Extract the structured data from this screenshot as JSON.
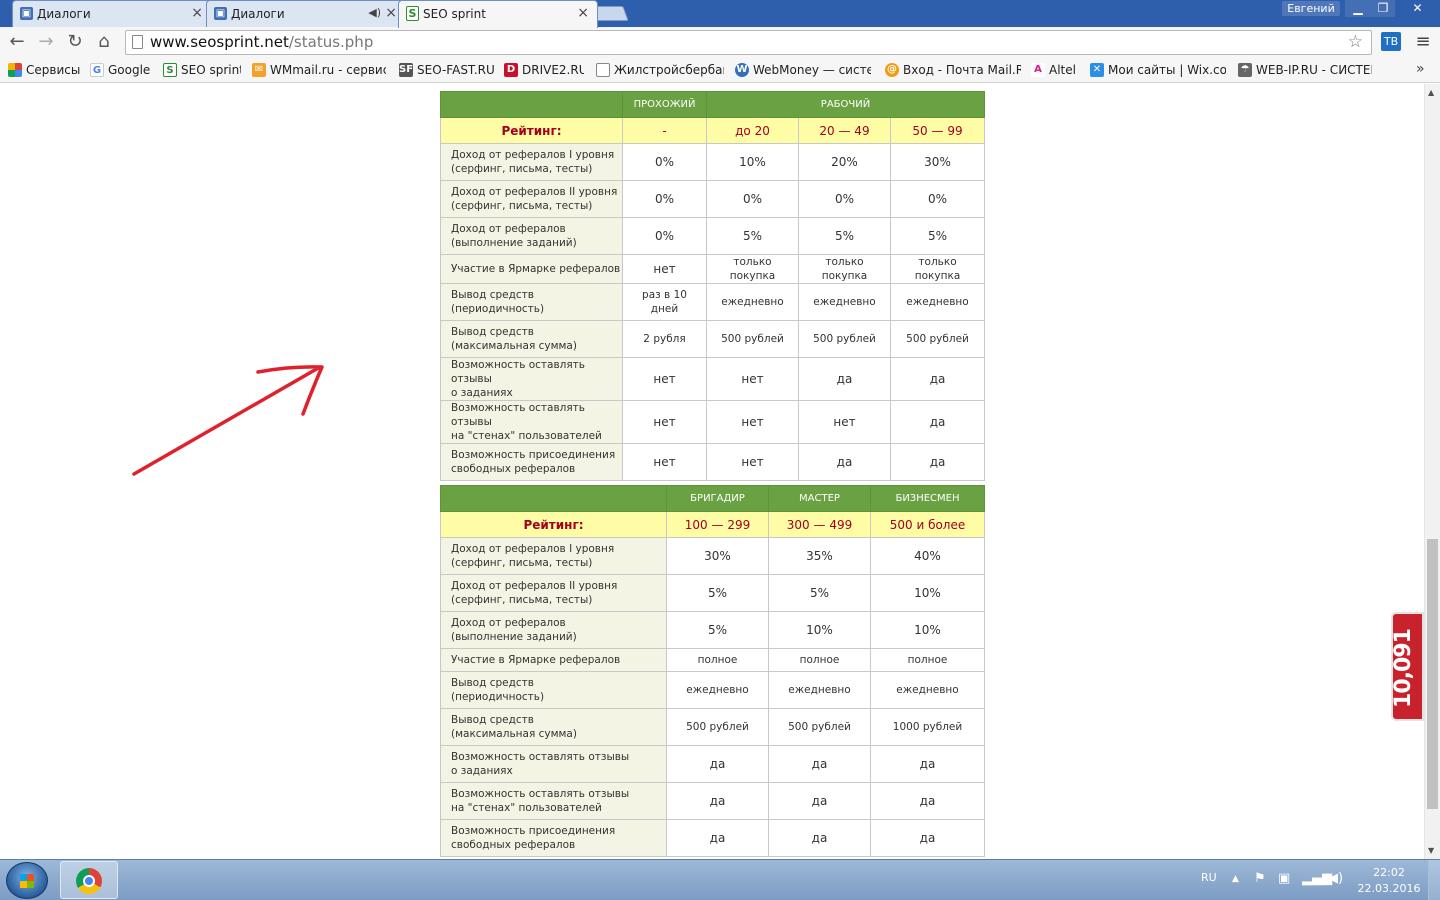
{
  "browser": {
    "tabs": [
      {
        "title": "Диалоги"
      },
      {
        "title": "Диалоги"
      },
      {
        "title": "SEO sprint"
      }
    ],
    "close_glyph": "×",
    "user": "Евгений",
    "url_host": "www.seosprint.net",
    "url_path": "/status.php",
    "bookmarks": [
      {
        "label": "Сервисы",
        "icon": "apps-grid-icon"
      },
      {
        "label": "Google",
        "icon": "google-icon"
      },
      {
        "label": "SEO sprint",
        "icon": "seosprint-icon"
      },
      {
        "label": "WMmail.ru - сервис п",
        "icon": "wmmail-icon"
      },
      {
        "label": "SEO-FAST.RU",
        "icon": "seofast-icon"
      },
      {
        "label": "DRIVE2.RU",
        "icon": "drive2-icon"
      },
      {
        "label": "Жилстройсбербанк",
        "icon": "page-icon"
      },
      {
        "label": "WebMoney — систем",
        "icon": "webmoney-icon"
      },
      {
        "label": "Вход - Почта Mail.Ru",
        "icon": "mailru-icon"
      },
      {
        "label": "Altel",
        "icon": "altel-icon"
      },
      {
        "label": "Мои сайты | Wix.com",
        "icon": "wix-icon"
      },
      {
        "label": "WEB-IP.RU - СИСТЕМ",
        "icon": "webip-icon"
      }
    ],
    "extension_label": "ТВ"
  },
  "table1": {
    "group_headers": [
      "ПРОХОЖИЙ",
      "РАБОЧИЙ"
    ],
    "rating_label": "Рейтинг:",
    "ratings": [
      "-",
      "до 20",
      "20 — 49",
      "50 — 99"
    ],
    "rows": [
      {
        "label": [
          "Доход от рефералов I уровня",
          "(серфинг, письма, тесты)"
        ],
        "values": [
          "0%",
          "10%",
          "20%",
          "30%"
        ]
      },
      {
        "label": [
          "Доход от рефералов II уровня",
          "(серфинг, письма, тесты)"
        ],
        "values": [
          "0%",
          "0%",
          "0%",
          "0%"
        ]
      },
      {
        "label": [
          "Доход от рефералов",
          "(выполнение заданий)"
        ],
        "values": [
          "0%",
          "5%",
          "5%",
          "5%"
        ]
      },
      {
        "label": [
          "Участие в Ярмарке рефералов",
          ""
        ],
        "values": [
          "нет",
          "только покупка",
          "только покупка",
          "только покупка"
        ]
      },
      {
        "label": [
          "Вывод средств",
          "(периодичность)"
        ],
        "values": [
          "раз в 10 дней",
          "ежедневно",
          "ежедневно",
          "ежедневно"
        ]
      },
      {
        "label": [
          "Вывод средств",
          "(максимальная сумма)"
        ],
        "values": [
          "2 рубля",
          "500 рублей",
          "500 рублей",
          "500 рублей"
        ]
      },
      {
        "label": [
          "Возможность оставлять отзывы",
          "о заданиях"
        ],
        "values": [
          "нет",
          "нет",
          "да",
          "да"
        ]
      },
      {
        "label": [
          "Возможность оставлять отзывы",
          "на \"стенах\" пользователей"
        ],
        "values": [
          "нет",
          "нет",
          "нет",
          "да"
        ]
      },
      {
        "label": [
          "Возможность присоединения",
          "свободных рефералов"
        ],
        "values": [
          "нет",
          "нет",
          "да",
          "да"
        ]
      }
    ]
  },
  "table2": {
    "headers": [
      "БРИГАДИР",
      "МАСТЕР",
      "БИЗНЕСМЕН"
    ],
    "rating_label": "Рейтинг:",
    "ratings": [
      "100 — 299",
      "300 — 499",
      "500 и более"
    ],
    "rows": [
      {
        "label": [
          "Доход от рефералов I уровня",
          "(серфинг, письма, тесты)"
        ],
        "values": [
          "30%",
          "35%",
          "40%"
        ]
      },
      {
        "label": [
          "Доход от рефералов II уровня",
          "(серфинг, письма, тесты)"
        ],
        "values": [
          "5%",
          "5%",
          "10%"
        ]
      },
      {
        "label": [
          "Доход от рефералов",
          "(выполнение заданий)"
        ],
        "values": [
          "5%",
          "10%",
          "10%"
        ]
      },
      {
        "label": [
          "Участие в Ярмарке рефералов",
          ""
        ],
        "values": [
          "полное",
          "полное",
          "полное"
        ]
      },
      {
        "label": [
          "Вывод средств",
          "(периодичность)"
        ],
        "values": [
          "ежедневно",
          "ежедневно",
          "ежедневно"
        ]
      },
      {
        "label": [
          "Вывод средств",
          "(максимальная сумма)"
        ],
        "values": [
          "500 рублей",
          "500 рублей",
          "1000 рублей"
        ]
      },
      {
        "label": [
          "Возможность оставлять отзывы",
          "о заданиях"
        ],
        "values": [
          "да",
          "да",
          "да"
        ]
      },
      {
        "label": [
          "Возможность оставлять отзывы",
          "на \"стенах\" пользователей"
        ],
        "values": [
          "да",
          "да",
          "да"
        ]
      },
      {
        "label": [
          "Возможность присоединения",
          "свободных рефералов"
        ],
        "values": [
          "да",
          "да",
          "да"
        ]
      }
    ]
  },
  "widget_count": "10,091",
  "taskbar": {
    "lang": "RU",
    "time": "22:02",
    "date": "22.03.2016"
  },
  "colors": {
    "header_green": "#6aa143",
    "rating_yellow": "#fffca6",
    "rating_text": "#a4001d",
    "arrow_red": "#e0202a",
    "widget_red": "#c8232c"
  }
}
